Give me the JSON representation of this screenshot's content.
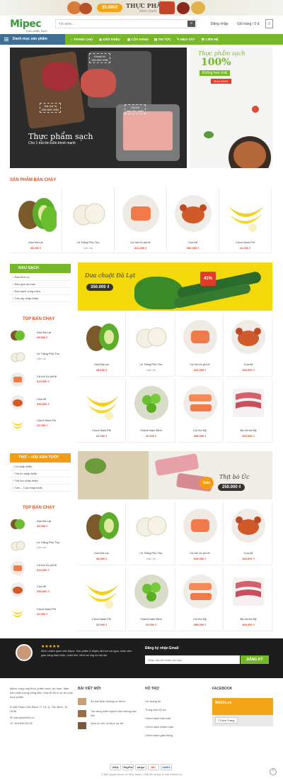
{
  "top_banner": {
    "price": "35.000đ",
    "title": "THỰC PHẨM",
    "subtitle": "Hàn Quốc"
  },
  "header": {
    "logo": "Mipec",
    "logo_sub": "Thực phẩm Sạch",
    "search_placeholder": "Tìm kiếm...",
    "login": "Đăng nhập",
    "cart_label": "Giỏ hàng / 0 đ",
    "cart_count": "0"
  },
  "nav": {
    "categories": "Danh mục sản phẩm",
    "items": [
      "TRANG CHỦ",
      "GIỚI THIỆU",
      "CỬA HÀNG",
      "TIN TỨC",
      "MẸO VẶT",
      "LIÊN HỆ"
    ]
  },
  "hero": {
    "title": "Thực phẩm sạch",
    "subtitle": "Cho 1 trái tim luôn khoẻ mạnh",
    "tag1_name": "Khoai bò",
    "tag1_price": "150.000 VNĐ",
    "tag2_name": "Thịt Gà Ta",
    "tag2_price": "250.000 VNĐ",
    "tag3_name": "Cá hồi",
    "tag3_price": "300.000 VNĐ"
  },
  "side_banner": {
    "line1": "Thực phẩm sạch",
    "line2": "100%",
    "line3": "Không hoá chất",
    "button": "MUA NGAY"
  },
  "bestseller_title": "SẢN PHẨM BÁN CHẠY",
  "bestsellers": [
    {
      "name": "Kiwi Đà Lạt",
      "price": "45.000 ₫"
    },
    {
      "name": "Lê Trắng Phú Thọ",
      "price": "Liên hệ"
    },
    {
      "name": "Cá hồi Úc phi lê",
      "price": "310.000 ₫"
    },
    {
      "name": "Cua bể",
      "price": "330.000 ₫"
    },
    {
      "name": "Chuối Nam Phi",
      "price": "22.000 ₫"
    }
  ],
  "section1": {
    "header": "RAU SẠCH",
    "links": [
      "Rau hữu cơ",
      "Rau quả an toàn",
      "Rau sạch vùng miền",
      "Trái cây nhập khẩu"
    ],
    "top_title": "TOP BÁN CHẠY",
    "top": [
      {
        "name": "Kiwi Đà Lạt",
        "price": "45.000 ₫"
      },
      {
        "name": "Lê Trắng Phú Thọ",
        "price": "Liên hệ"
      },
      {
        "name": "Cá hồi Úc phi lê",
        "price": "310.000 ₫"
      },
      {
        "name": "Cua bể",
        "price": "330.000 ₫"
      },
      {
        "name": "Chuối Nam Phi",
        "price": "22.000 ₫"
      }
    ],
    "promo_title": "Dưa chuột Đà Lạt",
    "promo_price": "350.000 ₫",
    "promo_badge": "41%",
    "grid": [
      {
        "name": "Kiwi Đà Lạt",
        "price": "45.000 ₫"
      },
      {
        "name": "Lê Trắng Phú Thọ",
        "price": "Liên hệ"
      },
      {
        "name": "Cá hồi Úc phi lê",
        "price": "310.000 ₫"
      },
      {
        "name": "Cua bể",
        "price": "330.000 ₫"
      },
      {
        "name": "Chuối Nam Phi",
        "price": "22.000 ₫"
      },
      {
        "name": "Chanh Nam Định",
        "price": "10.000 ₫"
      },
      {
        "name": "Cá Hồi Mỹ",
        "price": "285.000 ₫"
      },
      {
        "name": "Ba chỉ bò Mỹ",
        "price": "400.000 ₫"
      }
    ]
  },
  "section2": {
    "header": "THỊT – HẢI SẢN TƯƠI",
    "links": [
      "Cá nhập khẩu",
      "Thịt bò nhập khẩu",
      "Thịt lợn nhập khẩu",
      "Tôm – Cua nhập khẩu"
    ],
    "top_title": "TOP BÁN CHẠY",
    "top": [
      {
        "name": "Kiwi Đà Lạt",
        "price": "45.000 ₫"
      },
      {
        "name": "Lê Trắng Phú Thọ",
        "price": "Liên hệ"
      },
      {
        "name": "Cá hồi Úc phi lê",
        "price": "310.000 ₫"
      },
      {
        "name": "Cua bể",
        "price": "330.000 ₫"
      },
      {
        "name": "Chuối Nam Phi",
        "price": "22.000 ₫"
      }
    ],
    "promo_title": "Thịt bò Úc",
    "promo_price": "250.000 ₫",
    "promo_badge": "Sale",
    "grid": [
      {
        "name": "Kiwi Đà Lạt",
        "price": "45.000 ₫"
      },
      {
        "name": "Lê Trắng Phú Thọ",
        "price": "Liên hệ"
      },
      {
        "name": "Cá hồi Úc phi lê",
        "price": "310.000 ₫"
      },
      {
        "name": "Cua bể",
        "price": "330.000 ₫"
      },
      {
        "name": "Chuối Nam Phi",
        "price": "22.000 ₫"
      },
      {
        "name": "Chanh Nam Định",
        "price": "10.000 ₫"
      },
      {
        "name": "Cá Hồi Mỹ",
        "price": "285.000 ₫"
      },
      {
        "name": "Ba chỉ bò Mỹ",
        "price": "400.000 ₫"
      }
    ]
  },
  "testimonial": {
    "stars": "★★★★★",
    "quote": "Mình nhiệm quen của Mipec. Sản phẩm ở Mipec rất tươi và ngon, nhân viên giao hàng thân thiện, nhiệt tình. Mình sẽ ủng hộ dài dài."
  },
  "newsletter": {
    "title": "Đăng ký nhận Email",
    "placeholder": "Nhập địa chỉ email của bạn",
    "button": "ĐĂNG KÝ"
  },
  "footer": {
    "about": "Mipec cung cấp thực phẩm sạch, an toàn, đảm bảo chất lượng hàng đầu. Xóa đi nỗi lo về an toàn thực phẩm",
    "address": "285 Phạm Văn Bạch, P. 15, Q. Tân Bình, Tp. HCM",
    "email": "hotro@web2s.vn",
    "phone": "094.999.92.95",
    "news_title": "BÀI VIẾT MỚI",
    "news": [
      "Ăn hạt định dưỡng có tốt ko",
      "Tác dụng kinh người của những loại hạt",
      "Quả óc chó có thực sự tốt"
    ],
    "support_title": "HỖ TRỢ",
    "support": [
      "Về chúng tôi",
      "Trung tâm hỗ trợ",
      "Chính sách bảo mật",
      "Chính sách thanh toán",
      "Chính sách giao hàng"
    ],
    "facebook_title": "FACEBOOK",
    "fb_page": "Web2s.vn",
    "fb_like": "Thích Trang",
    "payments": [
      "VISA",
      "PayPal",
      "stripe",
      "MC",
      "AMEX"
    ],
    "copyright": "© Bản quyền thuộc về W2s Team | Thiết kế và duy trì bởi Web2s.vn"
  }
}
